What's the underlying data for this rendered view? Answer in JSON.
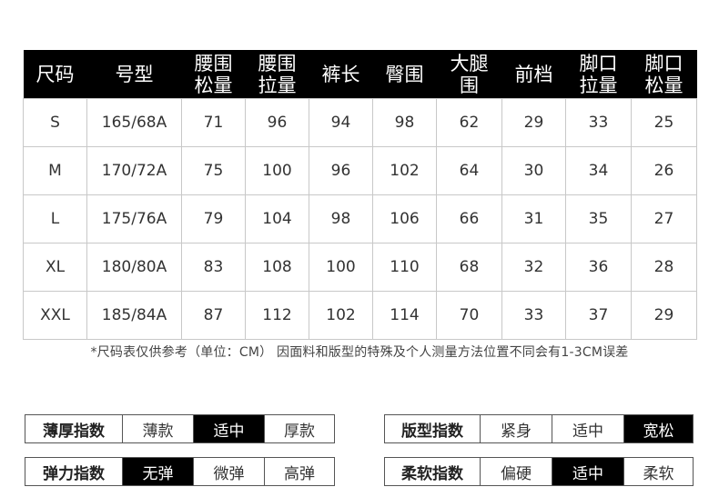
{
  "table": {
    "headers": [
      [
        "尺码"
      ],
      [
        "号型"
      ],
      [
        "腰围",
        "松量"
      ],
      [
        "腰围",
        "拉量"
      ],
      [
        "裤长"
      ],
      [
        "臀围"
      ],
      [
        "大腿",
        "围"
      ],
      [
        "前档"
      ],
      [
        "脚口",
        "拉量"
      ],
      [
        "脚口",
        "松量"
      ]
    ],
    "rows": [
      [
        "S",
        "165/68A",
        "71",
        "96",
        "94",
        "98",
        "62",
        "29",
        "33",
        "25"
      ],
      [
        "M",
        "170/72A",
        "75",
        "100",
        "96",
        "102",
        "64",
        "30",
        "34",
        "26"
      ],
      [
        "L",
        "175/76A",
        "79",
        "104",
        "98",
        "106",
        "66",
        "31",
        "35",
        "27"
      ],
      [
        "XL",
        "180/80A",
        "83",
        "108",
        "100",
        "110",
        "68",
        "32",
        "36",
        "28"
      ],
      [
        "XXL",
        "185/84A",
        "87",
        "112",
        "102",
        "114",
        "70",
        "33",
        "37",
        "29"
      ]
    ]
  },
  "note": "*尺码表仅供参考（单位：CM） 因面料和版型的特殊及个人测量方法位置不同会有1-3CM误差",
  "indices": {
    "thickness": {
      "title": "薄厚指数",
      "options": [
        "薄款",
        "适中",
        "厚款"
      ],
      "selected": 1
    },
    "elasticity": {
      "title": "弹力指数",
      "options": [
        "无弹",
        "微弹",
        "高弹"
      ],
      "selected": 0
    },
    "fit": {
      "title": "版型指数",
      "options": [
        "紧身",
        "适中",
        "宽松"
      ],
      "selected": 2
    },
    "softness": {
      "title": "柔软指数",
      "options": [
        "偏硬",
        "适中",
        "柔软"
      ],
      "selected": 1
    }
  },
  "colors": {
    "header_bg": "#000000",
    "selected_bg": "#000000",
    "border": "#c8c8c8"
  }
}
